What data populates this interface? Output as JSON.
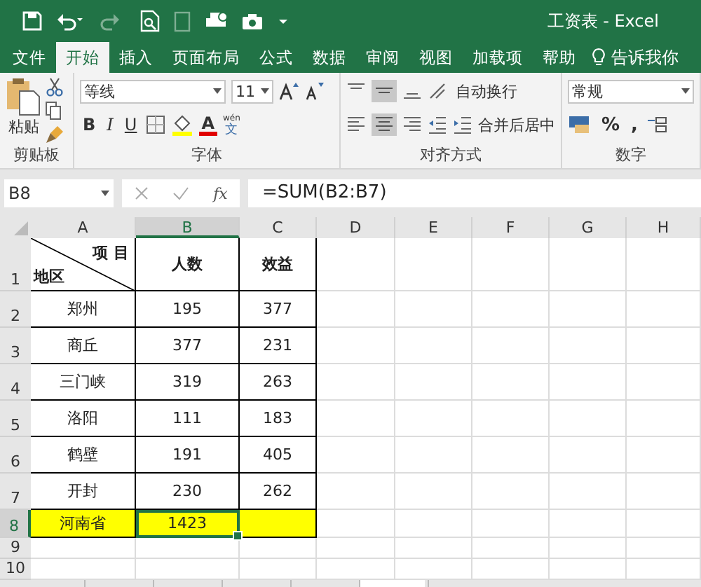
{
  "window": {
    "title": "工资表 - Excel"
  },
  "ribbon_tabs": [
    {
      "label": "文件",
      "selected": false
    },
    {
      "label": "开始",
      "selected": true
    },
    {
      "label": "插入",
      "selected": false
    },
    {
      "label": "页面布局",
      "selected": false
    },
    {
      "label": "公式",
      "selected": false
    },
    {
      "label": "数据",
      "selected": false
    },
    {
      "label": "审阅",
      "selected": false
    },
    {
      "label": "视图",
      "selected": false
    },
    {
      "label": "加载项",
      "selected": false
    },
    {
      "label": "帮助",
      "selected": false
    }
  ],
  "tell_me": "告诉我你",
  "ribbon": {
    "paste_label": "粘贴",
    "font_name": "等线",
    "font_size": "11",
    "bold": "B",
    "italic": "I",
    "underline": "U",
    "font_color": "A",
    "phonetic_top": "wén",
    "phonetic_bottom": "文",
    "wrap_text": "自动换行",
    "merge_center": "合并后居中",
    "number_format": "常规",
    "percent": "%",
    "comma": ",",
    "groups": [
      "剪贴板",
      "字体",
      "对齐方式",
      "数字"
    ]
  },
  "formula_bar": {
    "name_box": "B8",
    "fx": "fx",
    "formula": "=SUM(B2:B7)"
  },
  "columns": [
    {
      "label": "A",
      "selected": false
    },
    {
      "label": "B",
      "selected": true
    },
    {
      "label": "C",
      "selected": false
    },
    {
      "label": "D",
      "selected": false
    },
    {
      "label": "E",
      "selected": false
    },
    {
      "label": "F",
      "selected": false
    },
    {
      "label": "G",
      "selected": false
    },
    {
      "label": "H",
      "selected": false
    }
  ],
  "rows": [
    {
      "number": "1",
      "selected": false,
      "highlight": false,
      "kind": "header",
      "cells": [
        "",
        "人数",
        "效益"
      ],
      "cell_selected": [
        false,
        false,
        false
      ],
      "diag_top": "项 目",
      "diag_bottom": "地区"
    },
    {
      "number": "2",
      "selected": false,
      "highlight": false,
      "kind": "data",
      "cells": [
        "郑州",
        "195",
        "377"
      ],
      "cell_selected": [
        false,
        false,
        false
      ]
    },
    {
      "number": "3",
      "selected": false,
      "highlight": false,
      "kind": "data",
      "cells": [
        "商丘",
        "377",
        "231"
      ],
      "cell_selected": [
        false,
        false,
        false
      ]
    },
    {
      "number": "4",
      "selected": false,
      "highlight": false,
      "kind": "data",
      "cells": [
        "三门峡",
        "319",
        "263"
      ],
      "cell_selected": [
        false,
        false,
        false
      ]
    },
    {
      "number": "5",
      "selected": false,
      "highlight": false,
      "kind": "data",
      "cells": [
        "洛阳",
        "111",
        "183"
      ],
      "cell_selected": [
        false,
        false,
        false
      ]
    },
    {
      "number": "6",
      "selected": false,
      "highlight": false,
      "kind": "data",
      "cells": [
        "鹤壁",
        "191",
        "405"
      ],
      "cell_selected": [
        false,
        false,
        false
      ]
    },
    {
      "number": "7",
      "selected": false,
      "highlight": false,
      "kind": "data",
      "cells": [
        "开封",
        "230",
        "262"
      ],
      "cell_selected": [
        false,
        false,
        false
      ]
    },
    {
      "number": "8",
      "selected": true,
      "highlight": true,
      "kind": "data",
      "cells": [
        "河南省",
        "1423",
        ""
      ],
      "cell_selected": [
        false,
        true,
        false
      ]
    },
    {
      "number": "9",
      "selected": false,
      "highlight": false,
      "kind": "empty",
      "cells": [
        "",
        "",
        ""
      ],
      "cell_selected": [
        false,
        false,
        false
      ]
    },
    {
      "number": "10",
      "selected": false,
      "highlight": false,
      "kind": "empty",
      "cells": [
        "",
        "",
        ""
      ],
      "cell_selected": [
        false,
        false,
        false
      ]
    }
  ],
  "sheet_tabs": [
    {
      "selected": false
    },
    {
      "selected": false
    },
    {
      "selected": false
    },
    {
      "selected": false
    },
    {
      "selected": true
    },
    {
      "selected": false
    }
  ]
}
